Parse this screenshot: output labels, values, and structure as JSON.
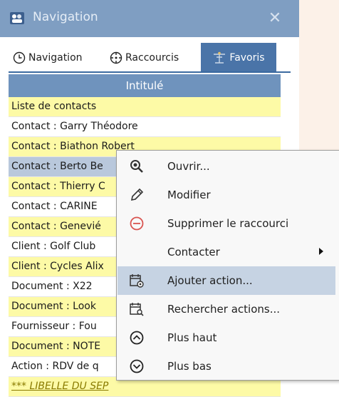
{
  "window": {
    "title": "Navigation",
    "close_glyph": "✕"
  },
  "tabs": [
    {
      "label": "Navigation",
      "icon": "clock-icon"
    },
    {
      "label": "Raccourcis",
      "icon": "crosshair-icon"
    },
    {
      "label": "Favoris",
      "icon": "favorites-icon",
      "active": true
    }
  ],
  "grid": {
    "header": "Intitulé",
    "rows": [
      {
        "text": "Liste de contacts",
        "style": "yellow"
      },
      {
        "text": "Contact : Garry Théodore",
        "style": "white"
      },
      {
        "text": "Contact : Biathon Robert",
        "style": "yellow"
      },
      {
        "text": "Contact : Berto Be",
        "style": "selected"
      },
      {
        "text": "Contact : Thierry C",
        "style": "yellow"
      },
      {
        "text": "Contact : CARINE",
        "style": "white"
      },
      {
        "text": "Contact : Genevié",
        "style": "yellow"
      },
      {
        "text": "Client : Golf Club",
        "style": "white"
      },
      {
        "text": "Client : Cycles Alix",
        "style": "yellow"
      },
      {
        "text": "Document : X22",
        "style": "white"
      },
      {
        "text": "Document : Look",
        "style": "yellow"
      },
      {
        "text": "Fournisseur : Fou",
        "style": "white"
      },
      {
        "text": "Document : NOTE",
        "style": "yellow"
      },
      {
        "text": "Action : RDV de q",
        "style": "white"
      },
      {
        "text": "*** LIBELLE DU SEP",
        "style": "yellow italic"
      }
    ]
  },
  "context_menu": {
    "items": [
      {
        "label": "Ouvrir...",
        "icon": "magnifier-icon"
      },
      {
        "label": "Modifier",
        "icon": "pencil-icon"
      },
      {
        "label": "Supprimer le raccourci",
        "icon": "remove-circle-icon"
      },
      {
        "label": "Contacter",
        "icon": "",
        "submenu": true
      },
      {
        "label": "Ajouter action...",
        "icon": "calendar-add-icon",
        "hover": true
      },
      {
        "label": "Rechercher actions...",
        "icon": "calendar-search-icon"
      },
      {
        "label": "Plus haut",
        "icon": "chevron-up-circle-icon"
      },
      {
        "label": "Plus bas",
        "icon": "chevron-down-circle-icon"
      }
    ]
  },
  "colors": {
    "titlebar": "#7f9ec2",
    "active_tab": "#4a74a8",
    "grid_header": "#6f93bd",
    "row_yellow": "#fdfaa6",
    "row_selected": "#b9c8dc",
    "menu_hover": "#c6d3e3",
    "remove_icon": "#d9534f"
  }
}
